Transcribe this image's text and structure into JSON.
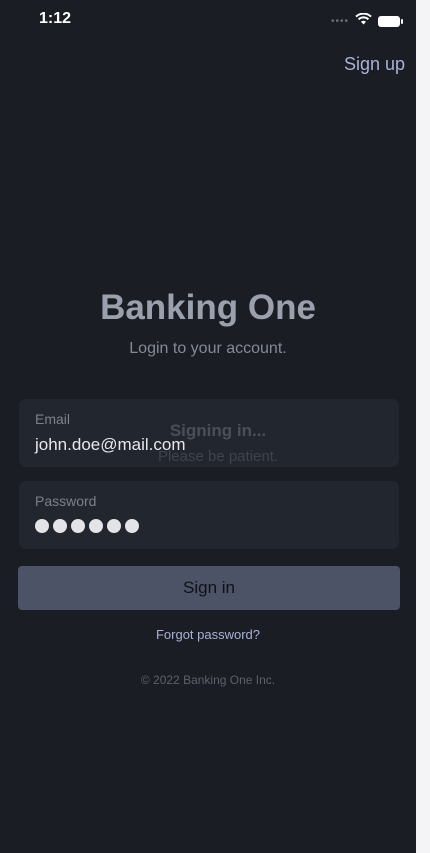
{
  "status_bar": {
    "time": "1:12",
    "icons": [
      "signal-icon",
      "wifi-icon",
      "battery-icon"
    ]
  },
  "header": {
    "signup_label": "Sign up"
  },
  "brand": {
    "title": "Banking One",
    "subtitle": "Login to your account."
  },
  "form": {
    "email": {
      "label": "Email",
      "value": "john.doe@mail.com"
    },
    "password": {
      "label": "Password",
      "masked_value": "●●●●●●"
    }
  },
  "overlay": {
    "title": "Signing in...",
    "subtitle": "Please be patient."
  },
  "actions": {
    "signin_label": "Sign in",
    "forgot_label": "Forgot password?"
  },
  "footer": {
    "copyright": "© 2022 Banking One Inc."
  },
  "colors": {
    "background": "#1a1d24",
    "field_background": "#22262e",
    "button": "#4c5366",
    "link": "#a9b2d6"
  }
}
